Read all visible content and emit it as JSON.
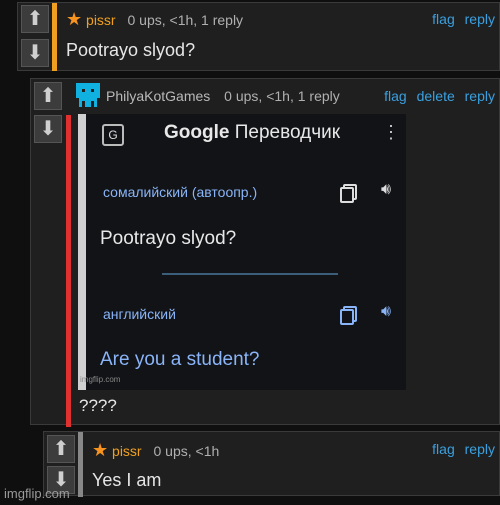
{
  "comment1": {
    "username": "pissr",
    "meta": "0 ups, <1h, 1 reply",
    "links": [
      "flag",
      "reply"
    ],
    "text": "Pootrayo slyod?",
    "accent_color": "#f0a020"
  },
  "comment2": {
    "username": "PhilyaKotGames",
    "meta": "0 ups, <1h, 1 reply",
    "links": [
      "flag",
      "delete",
      "reply"
    ],
    "text": "????",
    "accent_color": "#e03030"
  },
  "translate": {
    "title_brand": "Google",
    "title_rest": "Переводчик",
    "source_lang": "сомалийский (автоопр.)",
    "source_text": "Pootrayo slyod?",
    "target_lang": "английский",
    "target_text": "Are you a student?",
    "watermark": "imgflip.com",
    "menu_glyph": "⋮"
  },
  "comment3": {
    "username": "pissr",
    "meta": "0 ups, <1h",
    "links": [
      "flag",
      "reply"
    ],
    "text": "Yes I am",
    "accent_color": "#888888"
  },
  "watermark": "imgflip.com",
  "icons": {
    "upvote": "arrow-up-icon",
    "downvote": "arrow-down-icon",
    "star": "star-avatar-icon",
    "pixel_avatar": "pixel-invader-avatar-icon"
  }
}
